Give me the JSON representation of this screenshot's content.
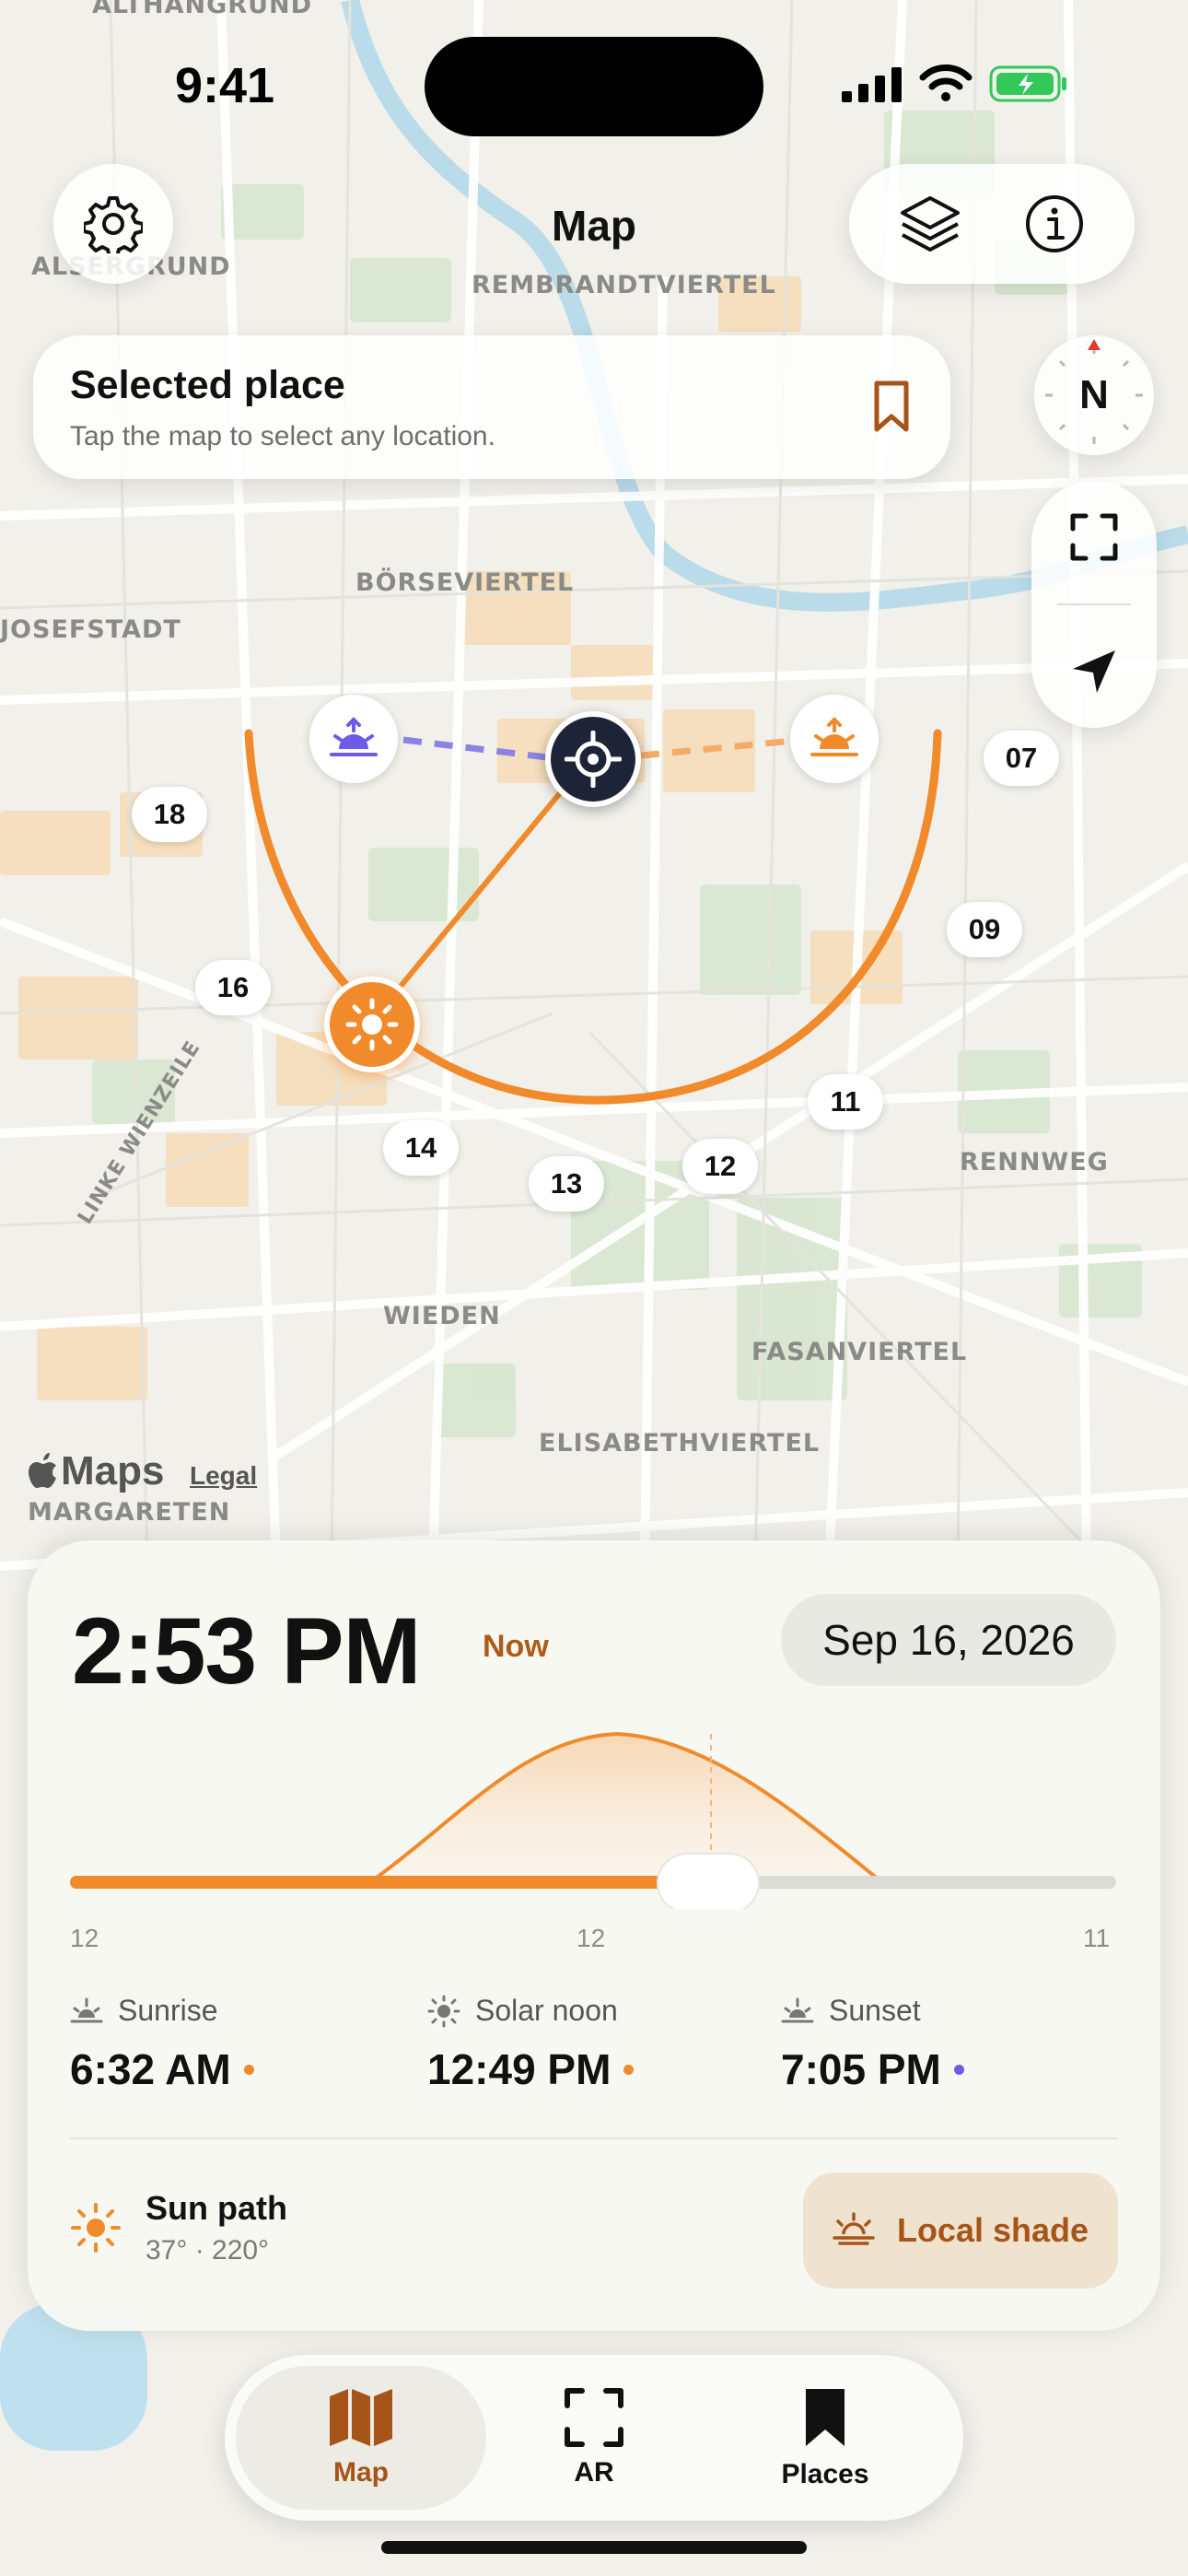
{
  "status_bar": {
    "time": "9:41"
  },
  "header": {
    "title": "Map"
  },
  "selected_place": {
    "title": "Selected place",
    "subtitle": "Tap the map to select any location."
  },
  "compass": {
    "label": "N"
  },
  "map": {
    "labels": [
      "ALTHANGRUND",
      "ALSERGRUND",
      "REMBRANDTVIERTEL",
      "BÖRSEVIERTEL",
      "JOSEFSTADT",
      "WIEDEN",
      "FASANVIERTEL",
      "ELISABETHVIERTEL",
      "MARGARETEN",
      "RENNWEG",
      "LINKE WIENZEILE"
    ],
    "hour_markers": [
      "18",
      "16",
      "14",
      "13",
      "12",
      "11",
      "09",
      "07"
    ],
    "attribution": "Maps",
    "legal": "Legal"
  },
  "sheet": {
    "time": "2:53 PM",
    "now_label": "Now",
    "date": "Sep 16, 2026",
    "timeline": {
      "ticks": [
        "12",
        "12",
        "11"
      ],
      "position": 0.61
    },
    "sunrise": {
      "label": "Sunrise",
      "value": "6:32 AM",
      "color": "#f08a2a"
    },
    "solar_noon": {
      "label": "Solar noon",
      "value": "12:49 PM",
      "color": "#f08a2a"
    },
    "sunset": {
      "label": "Sunset",
      "value": "7:05 PM",
      "color": "#6b5ce7"
    },
    "sun_path": {
      "title": "Sun path",
      "detail": "37° · 220°"
    },
    "local_shade": "Local shade"
  },
  "tabs": [
    {
      "label": "Map",
      "icon": "map-icon",
      "active": true
    },
    {
      "label": "AR",
      "icon": "ar-scan-icon",
      "active": false
    },
    {
      "label": "Places",
      "icon": "bookmark-icon",
      "active": false
    }
  ],
  "colors": {
    "accent": "#f08a2a",
    "accent_dark": "#a65417",
    "sunset_violet": "#6b5ce7",
    "location_navy": "#1d2438"
  }
}
